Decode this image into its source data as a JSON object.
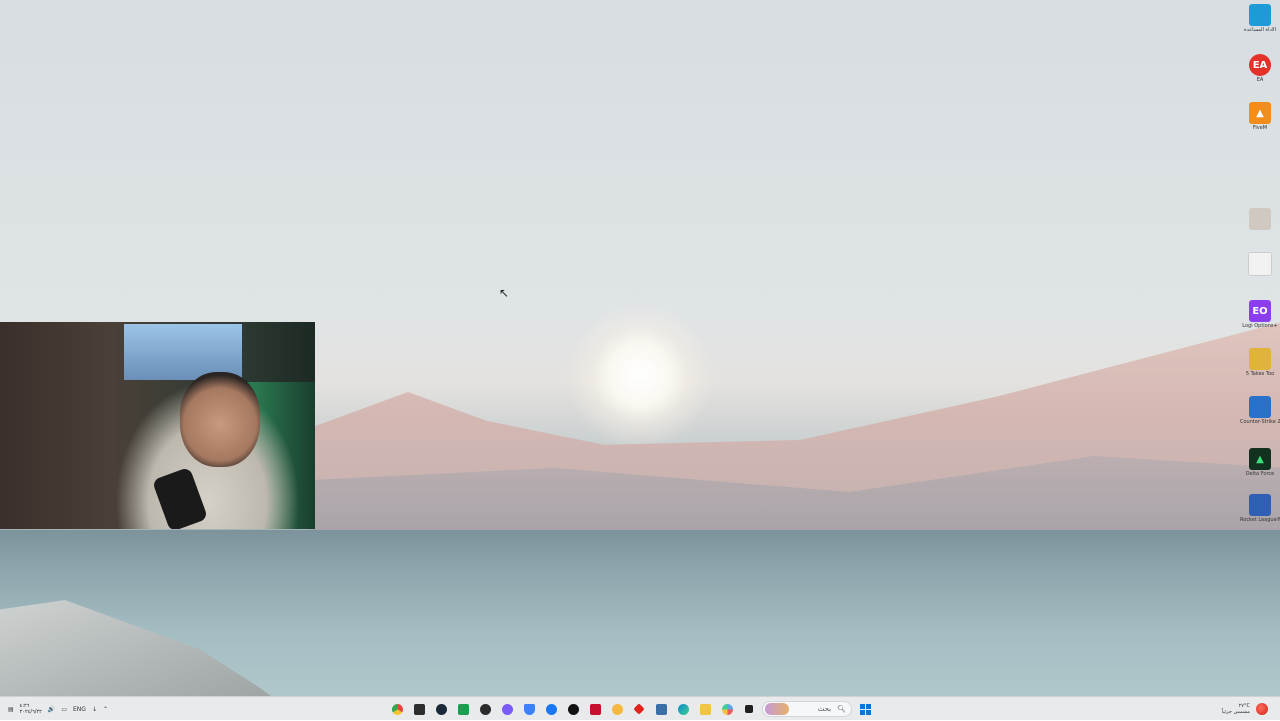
{
  "desktop": {
    "icons": [
      {
        "label": "الأداة المساعدة",
        "color": "#1e9ad6",
        "name": "monitor-app"
      },
      {
        "label": "EA",
        "color": "#e4312a",
        "name": "ea-app"
      },
      {
        "label": "FiveM",
        "color": "#f28c1a",
        "name": "fivem-app"
      },
      {
        "label": "",
        "color": "#cfc9c2",
        "name": "document-file"
      },
      {
        "label": "",
        "color": "#f2f2f2",
        "name": "blank-file"
      },
      {
        "label": "Logi Options+",
        "color": "#8b3df0",
        "name": "logi-options-app"
      },
      {
        "label": "5 Takes Too",
        "color": "#e0b43b",
        "name": "game-shortcut"
      },
      {
        "label": "Counter-Strike 2",
        "color": "#2a72c9",
        "name": "counter-strike-app"
      },
      {
        "label": "Delta Force",
        "color": "#12311f",
        "name": "delta-force-app"
      },
      {
        "label": "Rocket League®",
        "color": "#2f5fb2",
        "name": "rocket-league-app"
      }
    ]
  },
  "taskbar": {
    "left": {
      "language": "ENG",
      "clock_time": "٤:٢٦",
      "clock_date": "٢٠٢٤/٦/٢٢"
    },
    "search": {
      "placeholder": "بحث"
    },
    "right": {
      "temperature": "٢٧°C",
      "condition": "مشمس جزئياً"
    },
    "apps": [
      {
        "name": "chrome-icon",
        "color": "#e8453c"
      },
      {
        "name": "terminal-icon",
        "color": "#2d2d2d"
      },
      {
        "name": "steam-icon",
        "color": "#1b2838"
      },
      {
        "name": "nvidia-icon",
        "color": "#1d9e4f"
      },
      {
        "name": "obs-icon",
        "color": "#2b2b2b"
      },
      {
        "name": "messenger-icon",
        "color": "#7a5af8"
      },
      {
        "name": "shield-icon",
        "color": "#3b82f6"
      },
      {
        "name": "facebook-icon",
        "color": "#1877f2"
      },
      {
        "name": "tiktok-icon",
        "color": "#111111"
      },
      {
        "name": "mcafee-icon",
        "color": "#c8102e"
      },
      {
        "name": "chat-icon",
        "color": "#f5b942"
      },
      {
        "name": "ruby-icon",
        "color": "#e0231c"
      },
      {
        "name": "settings-icon",
        "color": "#3c6ea8"
      },
      {
        "name": "edge-icon",
        "color": "#0d8ad0"
      },
      {
        "name": "folder-icon",
        "color": "#f3c442"
      },
      {
        "name": "photos-icon",
        "color": "#5da6e8"
      },
      {
        "name": "app-icon",
        "color": "#1f1f1f"
      }
    ]
  }
}
